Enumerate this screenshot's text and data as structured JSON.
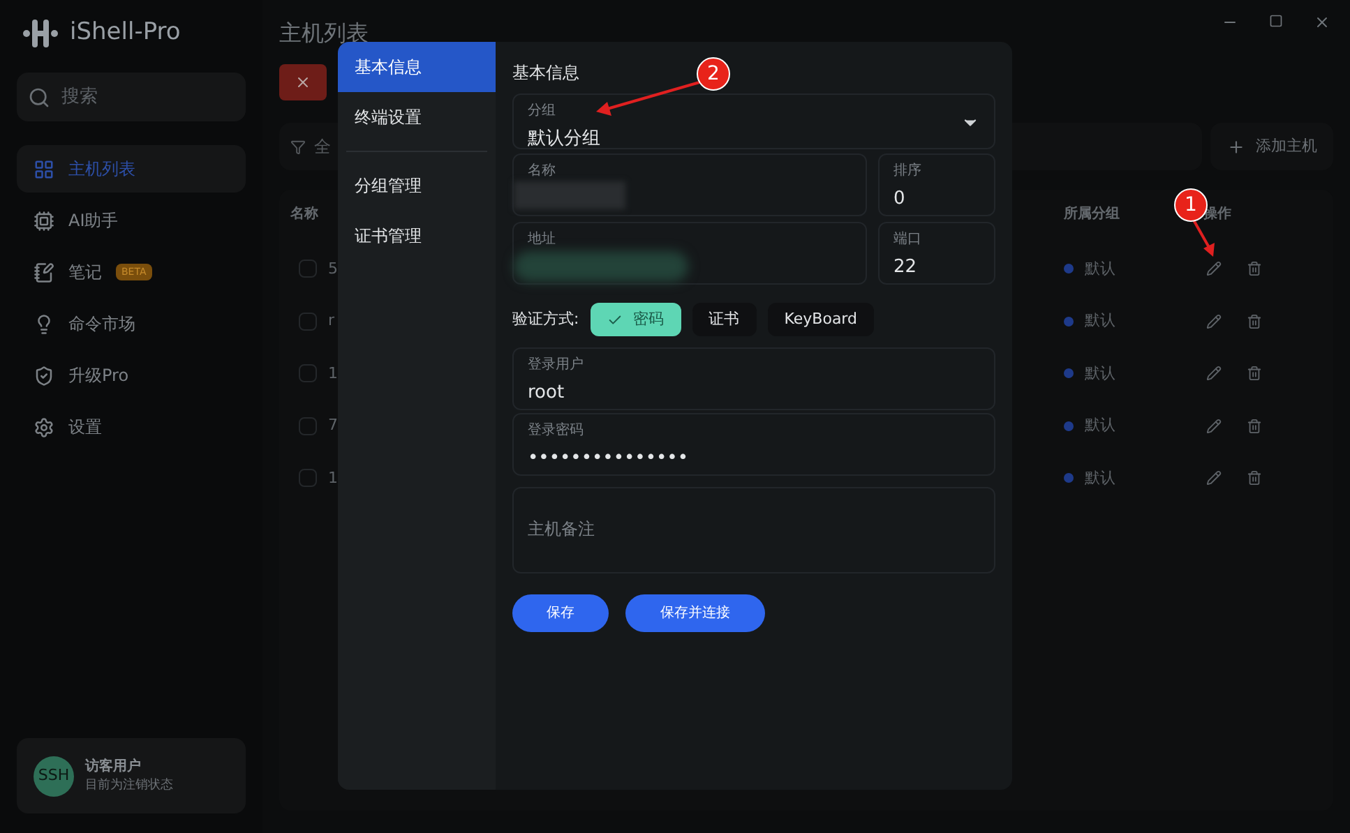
{
  "app": {
    "name": "iShell-Pro"
  },
  "sidebar": {
    "search": {
      "placeholder": "搜索"
    },
    "items": [
      {
        "label": "主机列表",
        "selected": true
      },
      {
        "label": "AI助手",
        "selected": false
      },
      {
        "label": "笔记",
        "selected": false,
        "badge": "BETA"
      },
      {
        "label": "命令市场",
        "selected": false
      },
      {
        "label": "升级Pro",
        "selected": false
      },
      {
        "label": "设置",
        "selected": false
      }
    ],
    "user": {
      "avatar": "SSH",
      "name": "访客用户",
      "status": "目前为注销状态"
    }
  },
  "main": {
    "title": "主机列表",
    "filter_label": "全",
    "add_button": "添加主机",
    "table": {
      "columns": [
        "名称",
        "所属分组",
        "操作"
      ],
      "rows": [
        {
          "name": "5",
          "group": "默认",
          "checked": false
        },
        {
          "name": "r",
          "group": "默认",
          "checked": false
        },
        {
          "name": "1",
          "group": "默认",
          "checked": false
        },
        {
          "name": "7",
          "group": "默认",
          "checked": false
        },
        {
          "name": "1",
          "group": "默认",
          "checked": false
        }
      ]
    }
  },
  "dialog": {
    "nav": [
      {
        "label": "基本信息",
        "selected": true,
        "divider_before": false
      },
      {
        "label": "终端设置",
        "selected": false,
        "divider_before": false
      },
      {
        "label": "分组管理",
        "selected": false,
        "divider_before": true
      },
      {
        "label": "证书管理",
        "selected": false,
        "divider_before": false
      }
    ],
    "section_title": "基本信息",
    "group_field": {
      "label": "分组",
      "value": "默认分组"
    },
    "name_field": {
      "label": "名称"
    },
    "sort_field": {
      "label": "排序",
      "value": "0"
    },
    "address_field": {
      "label": "地址"
    },
    "port_field": {
      "label": "端口",
      "value": "22"
    },
    "auth": {
      "label": "验证方式:",
      "options": [
        {
          "label": "密码",
          "selected": true
        },
        {
          "label": "证书",
          "selected": false
        },
        {
          "label": "KeyBoard",
          "selected": false
        }
      ]
    },
    "user_field": {
      "label": "登录用户",
      "value": "root"
    },
    "password_field": {
      "label": "登录密码",
      "value": "•••••••••••••••"
    },
    "notes_field": {
      "placeholder": "主机备注"
    },
    "buttons": [
      "保存",
      "保存并连接"
    ]
  },
  "annotations": [
    {
      "label": "1"
    },
    {
      "label": "2"
    }
  ]
}
